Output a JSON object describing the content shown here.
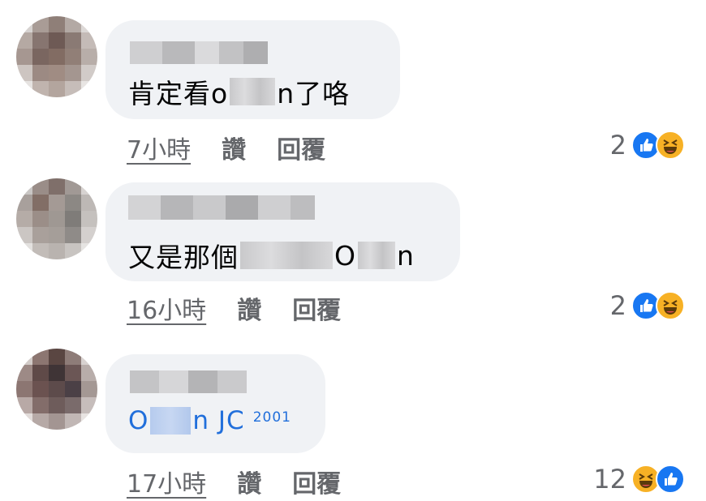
{
  "comments": [
    {
      "text_prefix": "肯定看o",
      "text_suffix": "n了咯",
      "time": "7小時",
      "like_label": "讚",
      "reply_label": "回覆",
      "reaction_count": "2",
      "reactions": [
        "like-icon",
        "haha-icon"
      ]
    },
    {
      "text_prefix": "又是那個",
      "text_mid": "O",
      "text_suffix": "n",
      "time": "16小時",
      "like_label": "讚",
      "reply_label": "回覆",
      "reaction_count": "2",
      "reactions": [
        "like-icon",
        "haha-icon"
      ]
    },
    {
      "text_prefix": "O",
      "text_suffix": "n JC",
      "superscript": "2001",
      "time": "17小時",
      "like_label": "讚",
      "reply_label": "回覆",
      "reaction_count": "12",
      "reactions": [
        "haha-icon",
        "like-icon"
      ]
    }
  ],
  "colors": {
    "bubble": "#f0f2f5",
    "link": "#216fdb",
    "meta": "#65676b",
    "like": "#1877f2",
    "haha": "#f7b125"
  }
}
